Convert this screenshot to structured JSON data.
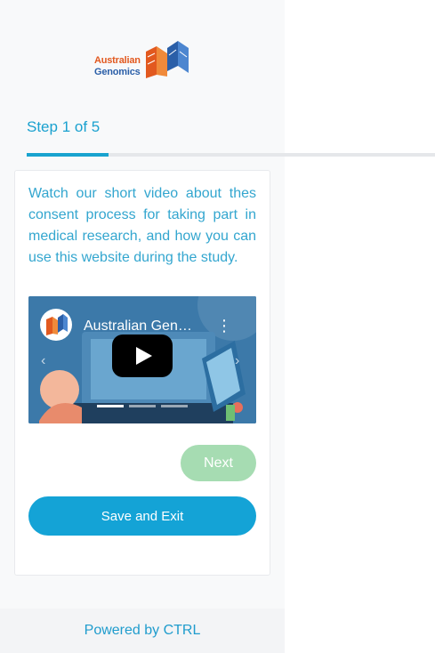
{
  "brand": {
    "logo_line1": "Australian",
    "logo_line2": "Genomics"
  },
  "progress": {
    "label": "Step 1 of 5",
    "current_step": 1,
    "total_steps": 5,
    "accent_color": "#19a3cf"
  },
  "content": {
    "intro_text": "Watch our short video about thes consent process for taking part in medical research, and how you can use this website during the study.",
    "video": {
      "title": "Australian Gen…",
      "menu_icon": "more-vert-icon",
      "play_icon": "play-icon",
      "carousel_slides": 3,
      "active_slide": 1
    }
  },
  "actions": {
    "next_label": "Next",
    "save_exit_label": "Save and Exit"
  },
  "footer": {
    "text": "Powered by CTRL"
  },
  "colors": {
    "primary": "#14a3d6",
    "next_disabled": "#a6dcb2",
    "panel_bg": "#f8f9fa"
  }
}
